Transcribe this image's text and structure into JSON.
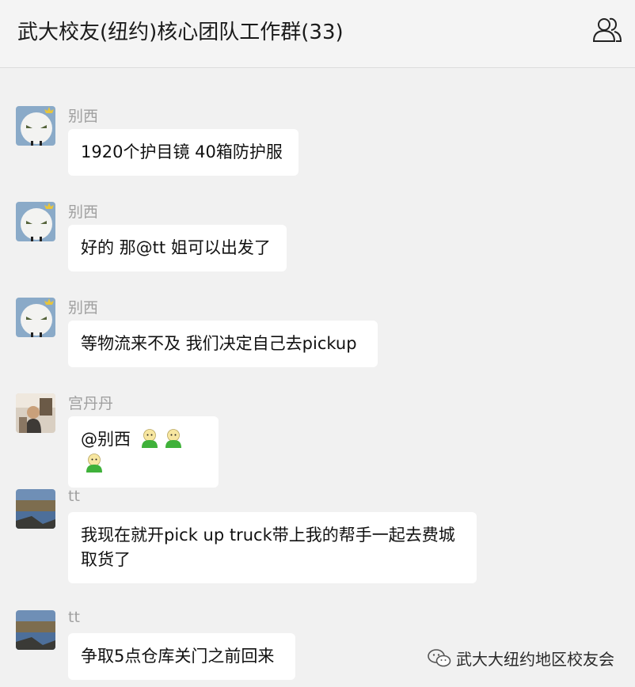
{
  "header": {
    "title": "武大校友(纽约)核心团队工作群(33)",
    "members_icon": "people-icon"
  },
  "messages": [
    {
      "sender": "别西",
      "text": "1920个护目镜 40箱防护服"
    },
    {
      "sender": "别西",
      "text": "好的 那@tt 姐可以出发了"
    },
    {
      "sender": "别西",
      "text": "等物流来不及 我们决定自己去pickup"
    },
    {
      "sender": "宫丹丹",
      "text": "@别西",
      "emoji": "green-face-emoji"
    },
    {
      "sender": "tt",
      "text": "我现在就开pick up truck带上我的帮手一起去费城取货了"
    },
    {
      "sender": "tt",
      "text": "争取5点仓库关门之前回来"
    }
  ],
  "watermark": {
    "text": "武大大纽约地区校友会",
    "icon": "wechat-icon"
  }
}
